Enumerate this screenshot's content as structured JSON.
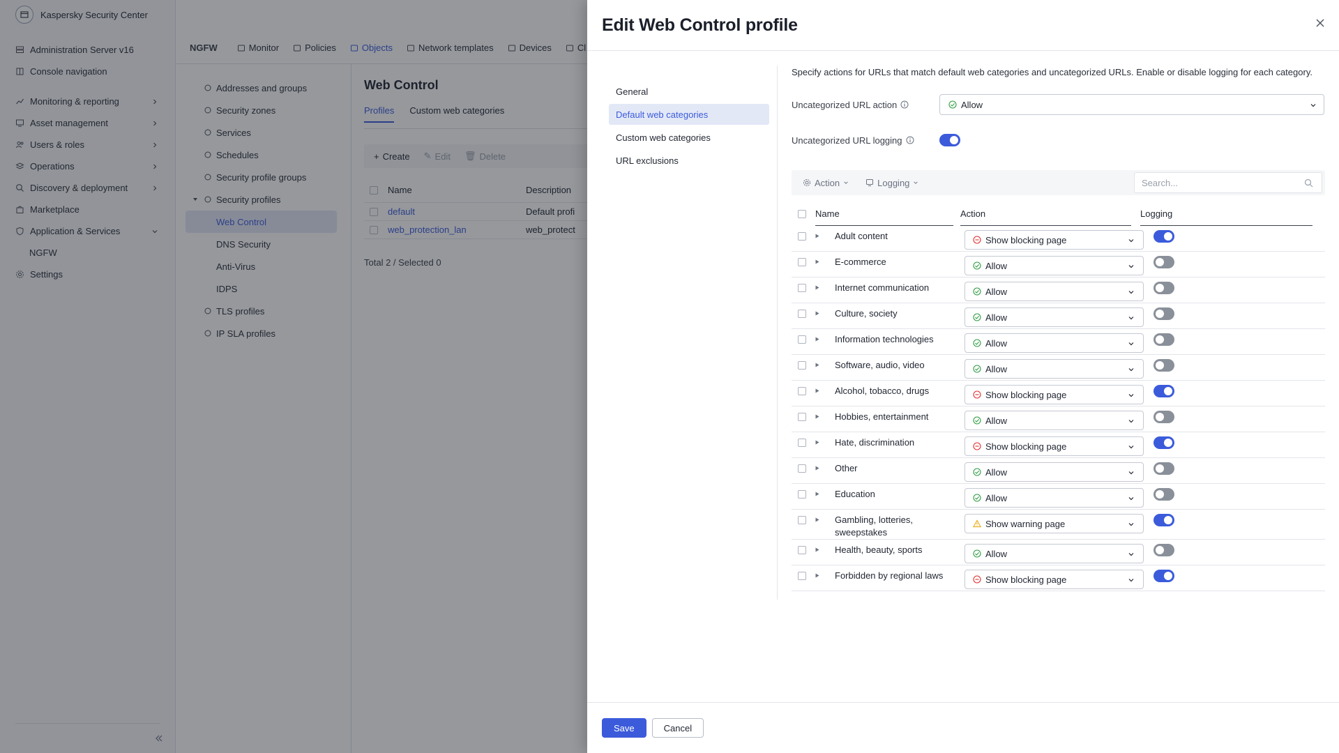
{
  "app": {
    "title": "Kaspersky Security Center",
    "nav": [
      {
        "label": "Administration Server v16",
        "icon": "server-icon",
        "chevron": false
      },
      {
        "label": "Console navigation",
        "icon": "book-icon",
        "chevron": false
      },
      {
        "label": "Monitoring & reporting",
        "icon": "chart-icon",
        "chevron": true
      },
      {
        "label": "Asset management",
        "icon": "monitor-icon",
        "chevron": true
      },
      {
        "label": "Users & roles",
        "icon": "users-icon",
        "chevron": true
      },
      {
        "label": "Operations",
        "icon": "stack-icon",
        "chevron": true
      },
      {
        "label": "Discovery & deployment",
        "icon": "search-icon",
        "chevron": true
      },
      {
        "label": "Marketplace",
        "icon": "bag-icon",
        "chevron": false
      },
      {
        "label": "Application & Services",
        "icon": "shield-icon",
        "chevron": true
      },
      {
        "label": "NGFW",
        "icon": "",
        "chevron": false,
        "sub": true
      },
      {
        "label": "Settings",
        "icon": "gear-icon",
        "chevron": false
      }
    ],
    "topbar": {
      "brand": "NGFW",
      "tabs": [
        {
          "label": "Monitor",
          "active": false
        },
        {
          "label": "Policies",
          "active": false
        },
        {
          "label": "Objects",
          "active": true
        },
        {
          "label": "Network templates",
          "active": false
        },
        {
          "label": "Devices",
          "active": false
        },
        {
          "label": "Cl",
          "active": false
        }
      ]
    },
    "objects_nav": [
      {
        "label": "Addresses and groups",
        "level": 1
      },
      {
        "label": "Security zones",
        "level": 1
      },
      {
        "label": "Services",
        "level": 1
      },
      {
        "label": "Schedules",
        "level": 1
      },
      {
        "label": "Security profile groups",
        "level": 1
      },
      {
        "label": "Security profiles",
        "level": 0
      },
      {
        "label": "Web Control",
        "level": 2,
        "active": true
      },
      {
        "label": "DNS Security",
        "level": 2
      },
      {
        "label": "Anti-Virus",
        "level": 2
      },
      {
        "label": "IDPS",
        "level": 2
      },
      {
        "label": "TLS profiles",
        "level": 1
      },
      {
        "label": "IP SLA profiles",
        "level": 1
      }
    ],
    "web_control": {
      "title": "Web Control",
      "tabs": [
        "Profiles",
        "Custom web categories"
      ],
      "toolbar": {
        "create": "Create",
        "edit": "Edit",
        "delete": "Delete"
      },
      "columns": [
        "Name",
        "Description"
      ],
      "rows": [
        {
          "name": "default",
          "description": "Default profi"
        },
        {
          "name": "web_protection_lan",
          "description": "web_protect"
        }
      ],
      "total": "Total 2 / Selected 0"
    }
  },
  "drawer": {
    "title": "Edit Web Control profile",
    "sidenav": [
      {
        "label": "General",
        "active": false
      },
      {
        "label": "Default web categories",
        "active": true
      },
      {
        "label": "Custom web categories",
        "active": false
      },
      {
        "label": "URL exclusions",
        "active": false
      }
    ],
    "description": "Specify actions for URLs that match default web categories and uncategorized URLs. Enable or disable logging for each category.",
    "uncategorized_action": {
      "label": "Uncategorized URL action",
      "value": "Allow"
    },
    "uncategorized_logging": {
      "label": "Uncategorized URL logging",
      "enabled": true
    },
    "filters": {
      "action": "Action",
      "logging": "Logging",
      "search_placeholder": "Search..."
    },
    "columns": {
      "name": "Name",
      "action": "Action",
      "logging": "Logging"
    },
    "categories": [
      {
        "name": "Adult content",
        "action": "Show blocking page",
        "status": "block",
        "logging": true
      },
      {
        "name": "E-commerce",
        "action": "Allow",
        "status": "allow",
        "logging": false
      },
      {
        "name": "Internet communication",
        "action": "Allow",
        "status": "allow",
        "logging": false
      },
      {
        "name": "Culture, society",
        "action": "Allow",
        "status": "allow",
        "logging": false
      },
      {
        "name": "Information technologies",
        "action": "Allow",
        "status": "allow",
        "logging": false
      },
      {
        "name": "Software, audio, video",
        "action": "Allow",
        "status": "allow",
        "logging": false
      },
      {
        "name": "Alcohol, tobacco, drugs",
        "action": "Show blocking page",
        "status": "block",
        "logging": true
      },
      {
        "name": "Hobbies, entertainment",
        "action": "Allow",
        "status": "allow",
        "logging": false
      },
      {
        "name": "Hate, discrimination",
        "action": "Show blocking page",
        "status": "block",
        "logging": true
      },
      {
        "name": "Other",
        "action": "Allow",
        "status": "allow",
        "logging": false
      },
      {
        "name": "Education",
        "action": "Allow",
        "status": "allow",
        "logging": false
      },
      {
        "name": "Gambling, lotteries, sweepstakes",
        "action": "Show warning page",
        "status": "warn",
        "logging": true
      },
      {
        "name": "Health, beauty, sports",
        "action": "Allow",
        "status": "allow",
        "logging": false
      },
      {
        "name": "Forbidden by regional laws",
        "action": "Show blocking page",
        "status": "block",
        "logging": true
      }
    ],
    "buttons": {
      "save": "Save",
      "cancel": "Cancel"
    }
  },
  "colors": {
    "accent": "#3b5bdb",
    "allow": "#2f9e44",
    "block": "#e03131",
    "warn": "#e8a500",
    "toggle_off": "#8a9099"
  }
}
